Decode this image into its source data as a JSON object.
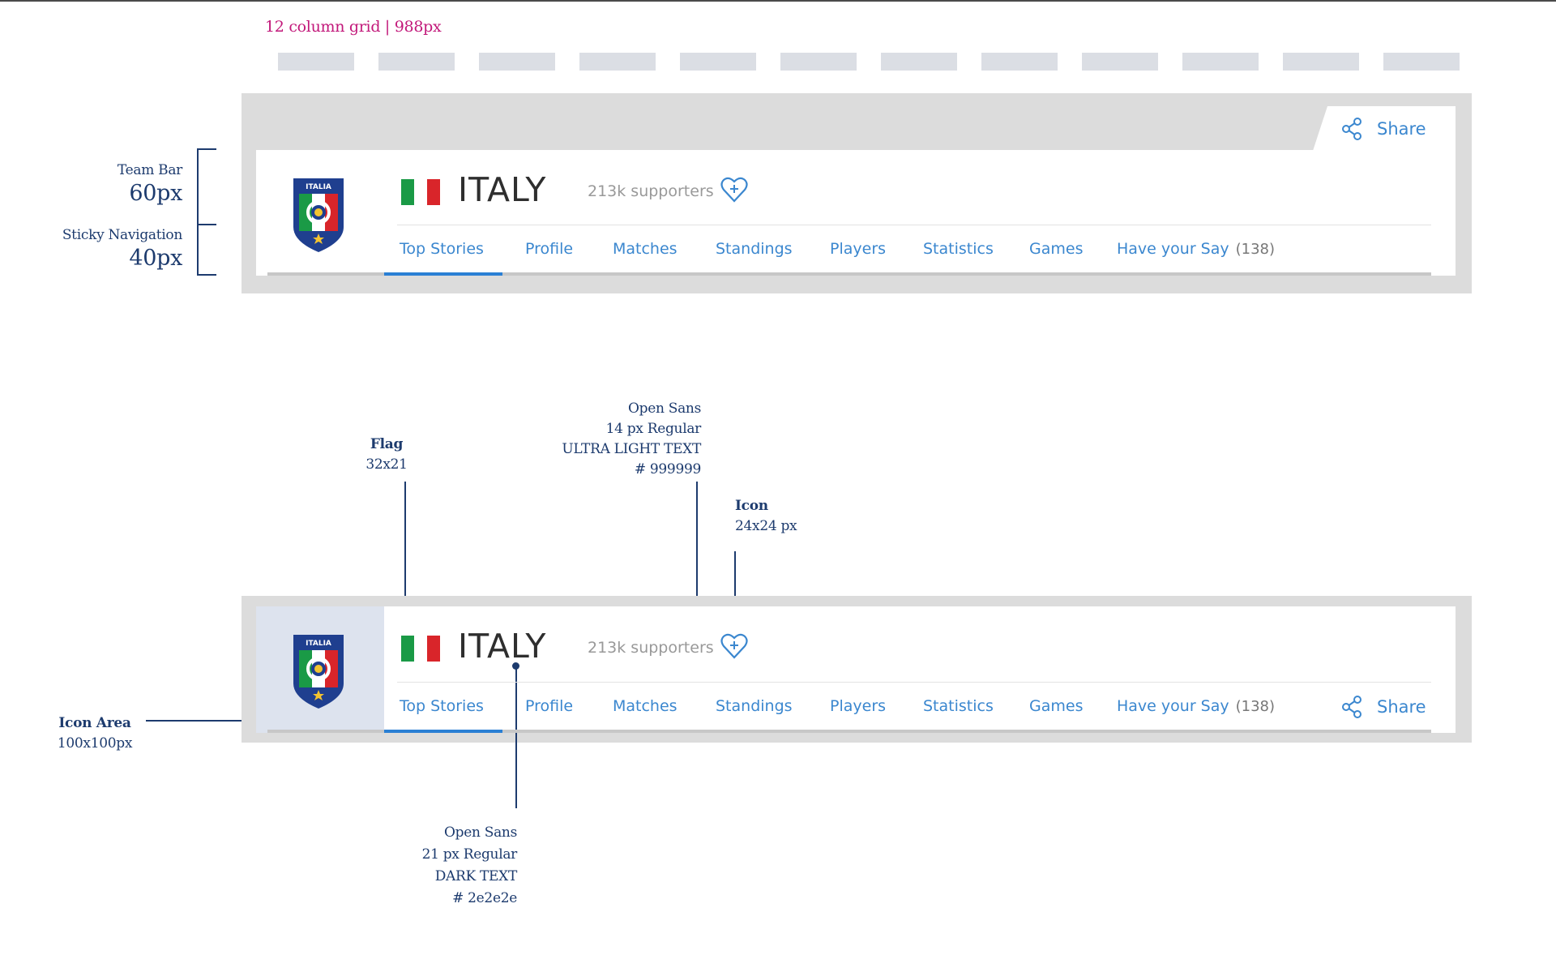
{
  "grid": {
    "title": "12 column grid | 988px",
    "columns": 12
  },
  "annotations": {
    "team_bar_label": "Team Bar",
    "team_bar_value": "60px",
    "sticky_nav_label": "Sticky Navigation",
    "sticky_nav_value": "40px",
    "flag_title": "Flag",
    "flag_size": "32x21",
    "support_font": "Open Sans",
    "support_size": "14 px Regular",
    "support_style": "ULTRA LIGHT TEXT",
    "support_color": "# 999999",
    "icon_title": "Icon",
    "icon_size": "24x24 px",
    "icon_area_title": "Icon Area",
    "icon_area_size": "100x100px",
    "name_font": "Open Sans",
    "name_size": "21 px Regular",
    "name_style": "DARK TEXT",
    "name_color": "# 2e2e2e"
  },
  "team": {
    "name": "ITALY",
    "supporters": "213k supporters",
    "crest_text": "ITALIA",
    "flag_colors": [
      "#1a9a46",
      "#ffffff",
      "#d9252a"
    ]
  },
  "nav": {
    "items": [
      "Top Stories",
      "Profile",
      "Matches",
      "Standings",
      "Players",
      "Statistics",
      "Games",
      "Have your Say"
    ],
    "count": "(138)",
    "active": "Top Stories"
  },
  "share": {
    "label": "Share"
  },
  "colors": {
    "accent": "#3b87cf",
    "dark_text": "#2e2e2e",
    "light_text": "#999999",
    "annotation": "#1d3b6e",
    "grid_title": "#c2187a"
  }
}
